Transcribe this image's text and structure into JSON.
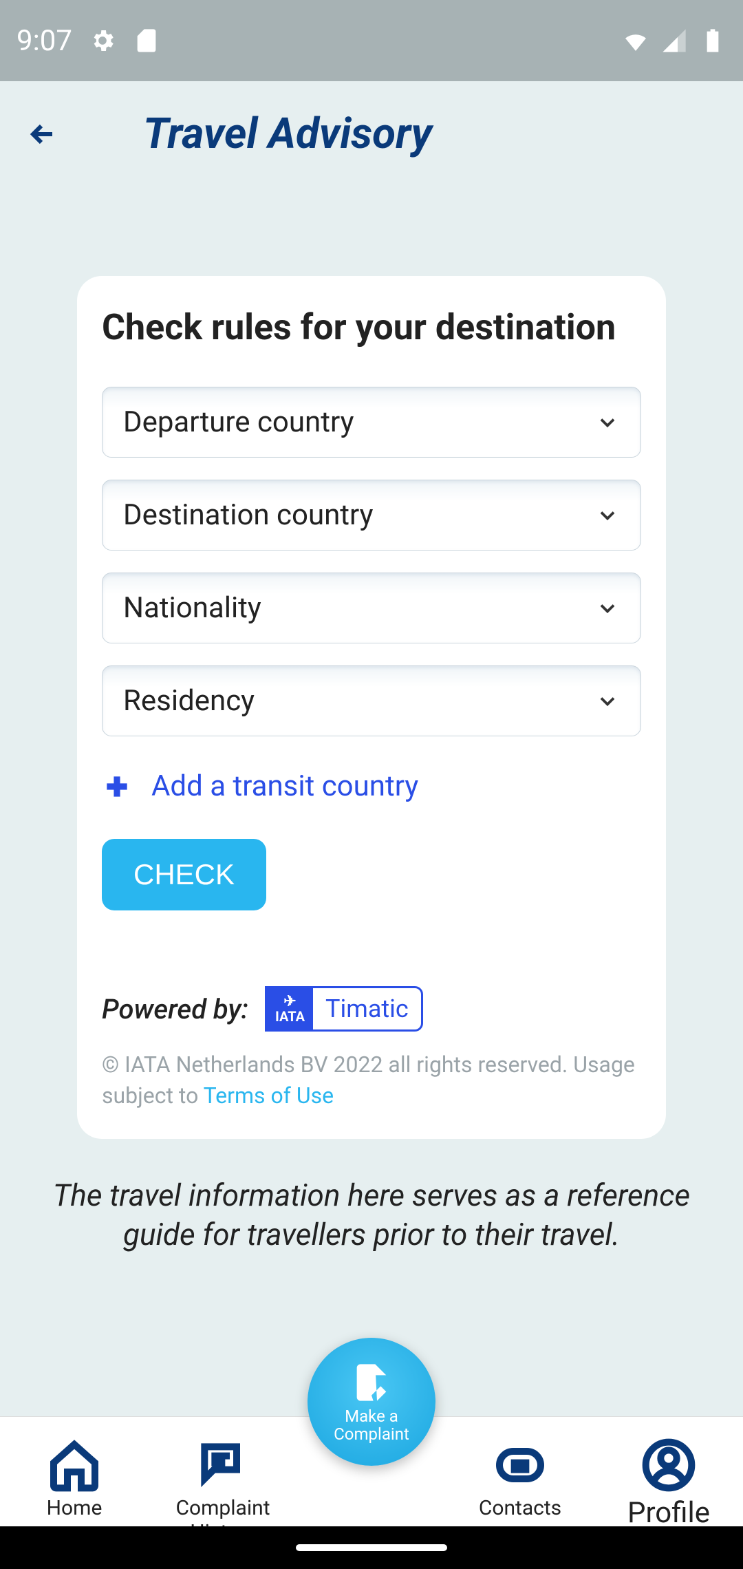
{
  "status": {
    "time": "9:07"
  },
  "header": {
    "title": "Travel Advisory"
  },
  "card": {
    "title": "Check rules for your destination",
    "fields": {
      "departure": "Departure country",
      "destination": "Destination country",
      "nationality": "Nationality",
      "residency": "Residency"
    },
    "add_transit": "Add a transit country",
    "check_button": "CHECK",
    "powered_by": "Powered by:",
    "timatic": {
      "iata": "IATA",
      "name": "Timatic"
    },
    "copyright": "© IATA Netherlands BV 2022 all rights reserved. Usage subject to ",
    "terms": "Terms of Use"
  },
  "disclaimer": "The travel information here serves as a reference guide for travellers prior to their travel.",
  "fab": {
    "line1": "Make a",
    "line2": "Complaint"
  },
  "nav": {
    "home": "Home",
    "complaint_history": "Complaint\nHistory",
    "contacts": "Contacts",
    "profile": "Profile"
  }
}
